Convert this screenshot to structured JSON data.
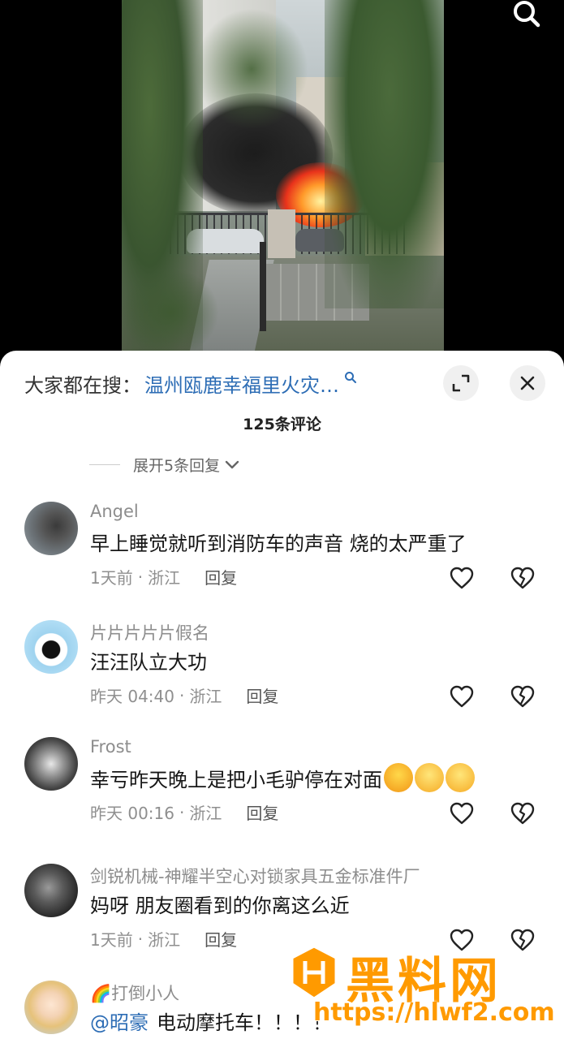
{
  "video": {
    "search_icon": "search-icon"
  },
  "header": {
    "trending_prefix": "大家都在搜：",
    "trending_query": "温州瓯鹿幸福里火灾…",
    "expand_icon": "expand-icon",
    "close_icon": "close-icon"
  },
  "comment_count": "125条评论",
  "expand_replies": "展开5条回复",
  "comments": [
    {
      "name": "Angel",
      "text": "早上睡觉就听到消防车的声音 烧的太严重了",
      "time": "1天前",
      "location": "浙江",
      "reply": "回复"
    },
    {
      "name": "片片片片片假名",
      "text": "汪汪队立大功",
      "time": "昨天 04:40",
      "location": "浙江",
      "reply": "回复"
    },
    {
      "name": "Frost",
      "text": "幸亏昨天晚上是把小毛驴停在对面",
      "time": "昨天 00:16",
      "location": "浙江",
      "reply": "回复"
    },
    {
      "name": "剑锐机械-神耀半空心对锁家具五金标准件厂",
      "text": "妈呀 朋友圈看到的你离这么近",
      "time": "1天前",
      "location": "浙江",
      "reply": "回复"
    },
    {
      "name": "🌈打倒小人",
      "mention": "@昭豪",
      "text": "电动摩托车！！！！",
      "time": "",
      "location": "",
      "reply": ""
    }
  ],
  "separator": "·",
  "watermark": {
    "name": "黑料网",
    "url": "https://hlwf2.com"
  },
  "colors": {
    "link": "#2d6db5",
    "watermark": "#ff9a00"
  }
}
